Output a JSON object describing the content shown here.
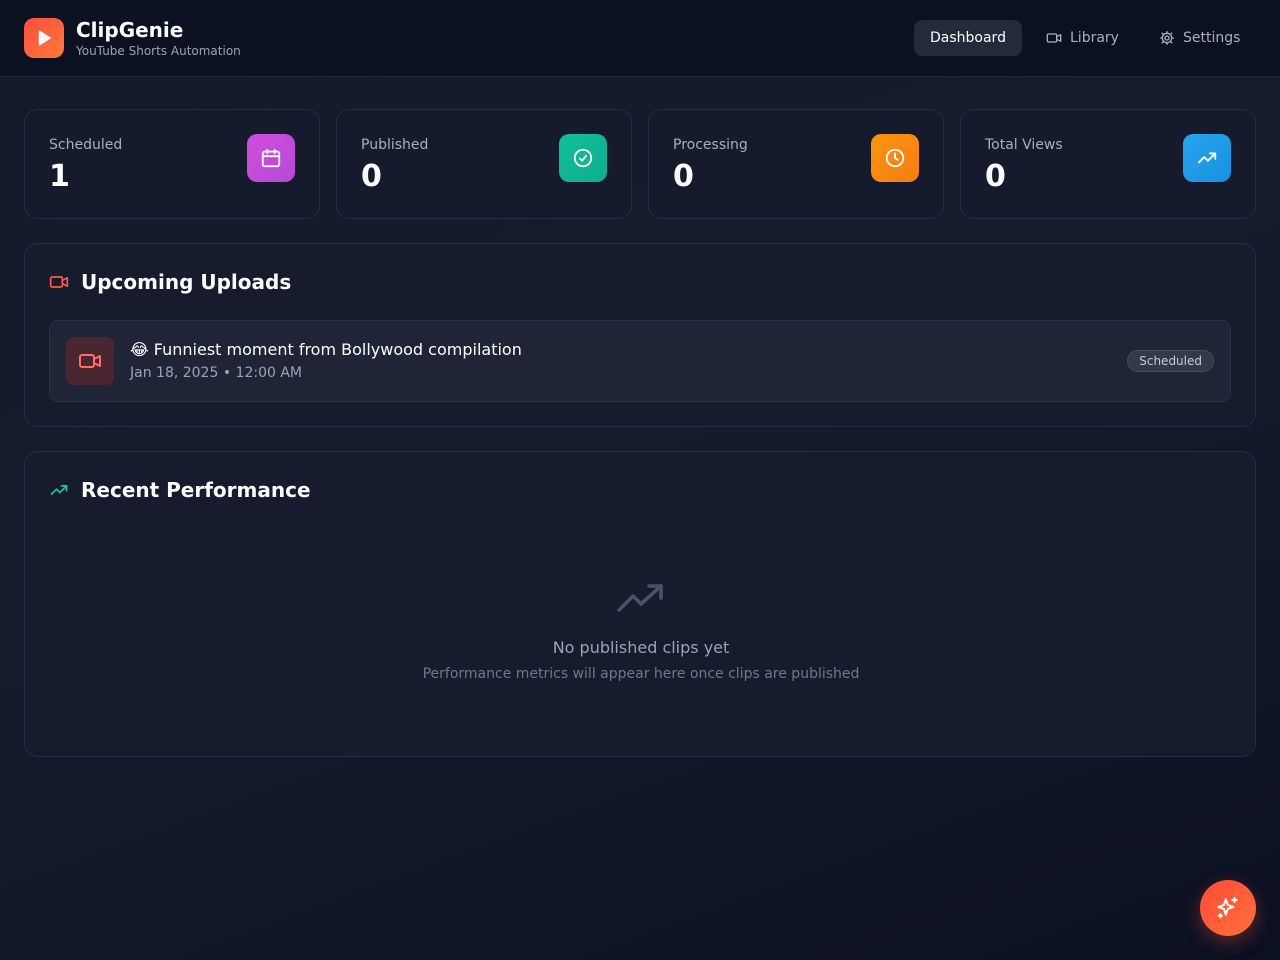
{
  "app": {
    "name": "ClipGenie",
    "tagline": "YouTube Shorts Automation",
    "logo_icon": "play-icon",
    "brand_gradient": [
      "#ff4d3d",
      "#ff7a3a"
    ]
  },
  "nav": {
    "items": [
      {
        "label": "Dashboard",
        "icon": "",
        "active": true
      },
      {
        "label": "Library",
        "icon": "video-camera-icon",
        "active": false
      },
      {
        "label": "Settings",
        "icon": "gear-icon",
        "active": false
      }
    ]
  },
  "stats": [
    {
      "label": "Scheduled",
      "value": "1",
      "icon": "calendar-icon",
      "color": "#c44ddb"
    },
    {
      "label": "Published",
      "value": "0",
      "icon": "check-circle-icon",
      "color": "#14b89a"
    },
    {
      "label": "Processing",
      "value": "0",
      "icon": "clock-icon",
      "color": "#f78a12"
    },
    {
      "label": "Total Views",
      "value": "0",
      "icon": "trending-up-icon",
      "color": "#1e9be6"
    }
  ],
  "upcoming": {
    "title": "Upcoming Uploads",
    "icon": "video-camera-icon",
    "items": [
      {
        "title": "😂 Funniest moment from Bollywood compilation",
        "meta": "Jan 18, 2025 • 12:00 AM",
        "status": "Scheduled",
        "icon": "video-camera-icon"
      }
    ]
  },
  "performance": {
    "title": "Recent Performance",
    "icon": "trending-up-icon",
    "empty_title": "No published clips yet",
    "empty_subtitle": "Performance metrics will appear here once clips are published"
  },
  "fab": {
    "icon": "sparkles-icon"
  }
}
